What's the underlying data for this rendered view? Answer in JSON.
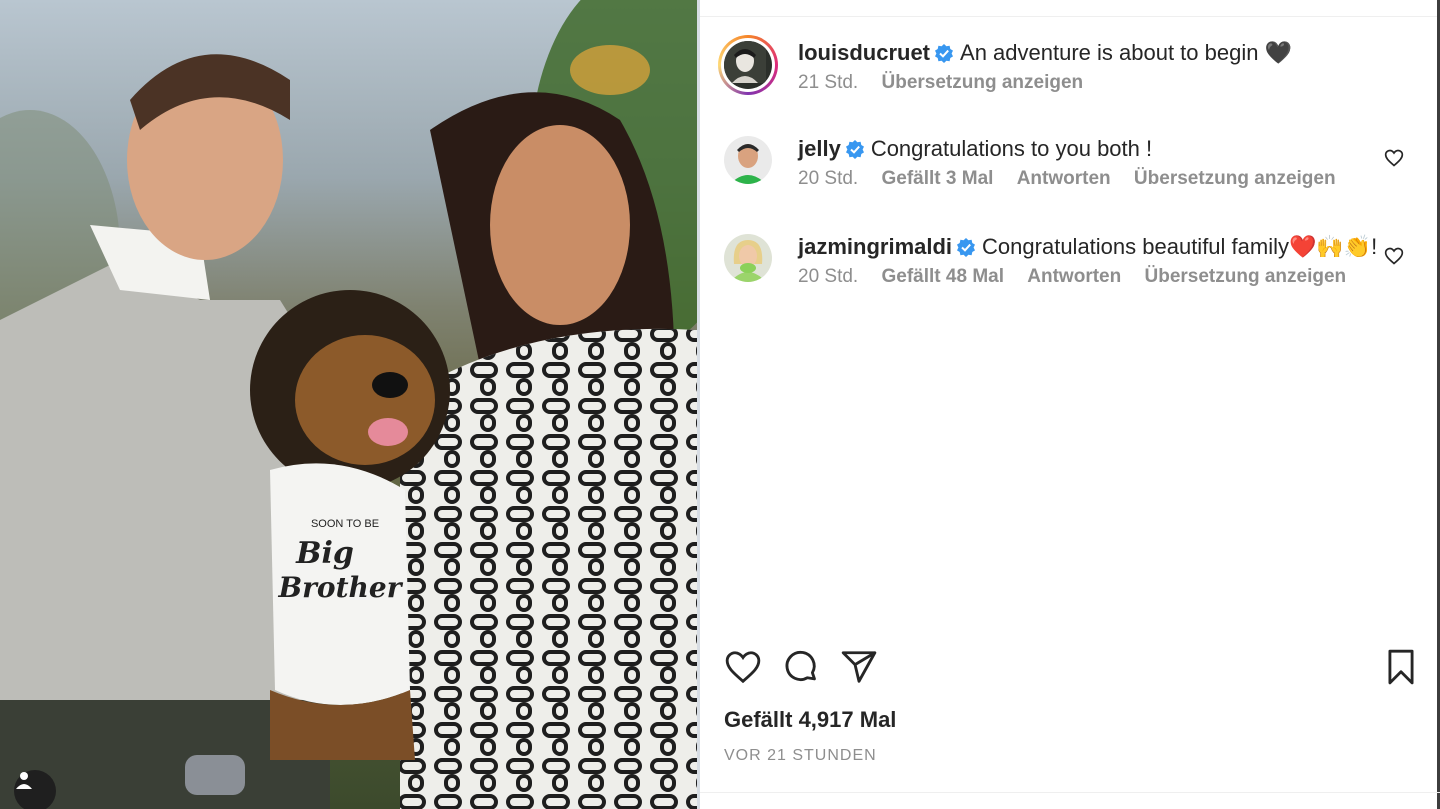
{
  "post": {
    "author": "louisducruet",
    "caption": "An adventure is about to begin 🖤",
    "time": "21 Std.",
    "translate": "Übersetzung anzeigen",
    "photo_shirt_line1": "SOON TO BE",
    "photo_shirt_line2": "Big",
    "photo_shirt_line3": "Brother"
  },
  "comments": [
    {
      "username": "jelly",
      "text": "Congratulations to you both !",
      "time": "20 Std.",
      "likes": "Gefällt 3 Mal",
      "reply": "Antworten",
      "translate": "Übersetzung anzeigen"
    },
    {
      "username": "jazmingrimaldi",
      "text": "Congratulations beautiful family❤️🙌👏!",
      "time": "20 Std.",
      "likes": "Gefällt 48 Mal",
      "reply": "Antworten",
      "translate": "Übersetzung anzeigen"
    }
  ],
  "footer": {
    "likes": "Gefällt 4,917 Mal",
    "posted_ago": "VOR 21 STUNDEN"
  },
  "icons": {
    "verified": "verified-badge-icon",
    "like": "heart-icon",
    "comment": "comment-icon",
    "share": "share-icon",
    "save": "bookmark-icon"
  },
  "colors": {
    "verified": "#3897f0",
    "meta_text": "#8e8e8e",
    "primary_text": "#262626"
  }
}
